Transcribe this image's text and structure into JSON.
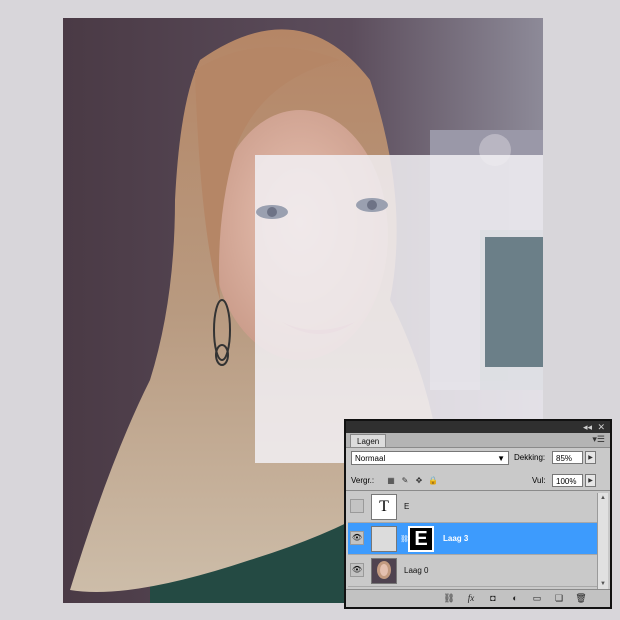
{
  "panel": {
    "tab_label": "Lagen",
    "blend_mode": "Normaal",
    "opacity_label": "Dekking:",
    "opacity_value": "85%",
    "lock_label": "Vergr.:",
    "fill_label": "Vul:",
    "fill_value": "100%",
    "layers": [
      {
        "name": "E",
        "visible": false,
        "selected": false,
        "thumb_text": "T"
      },
      {
        "name": "Laag 3",
        "visible": true,
        "selected": true,
        "mask_text": "E"
      },
      {
        "name": "Laag 0",
        "visible": true,
        "selected": false
      }
    ],
    "bottom_icons": [
      "link-icon",
      "fx-icon",
      "mask-icon",
      "adjustment-icon",
      "folder-icon",
      "new-layer-icon",
      "trash-icon"
    ],
    "colors": {
      "selected_row": "#3d9bfd",
      "panel_bg": "#c9c9c9"
    }
  }
}
